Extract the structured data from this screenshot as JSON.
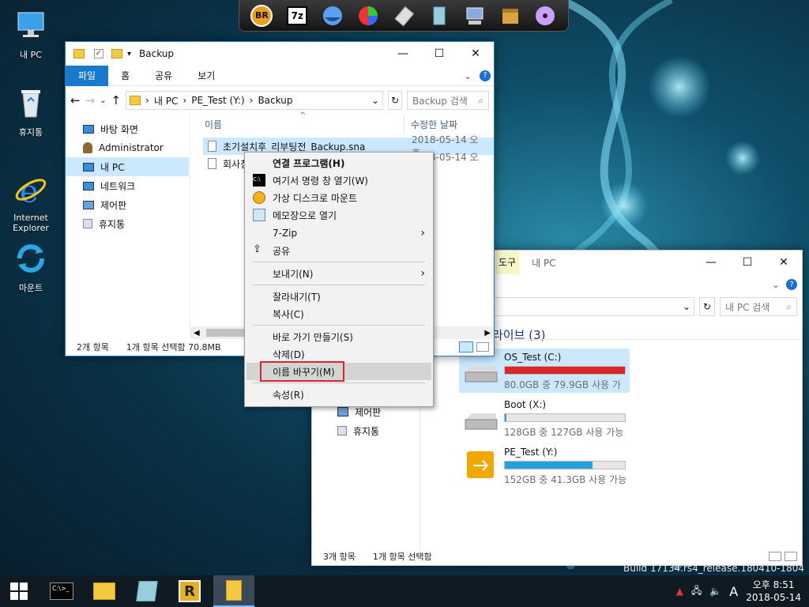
{
  "desktop": {
    "icons": [
      {
        "label": "내 PC"
      },
      {
        "label": "휴지통"
      },
      {
        "label": "Internet\nExplorer"
      },
      {
        "label": "마운트"
      }
    ],
    "build_text": "Build 17134.rs4_release.180410-1804"
  },
  "launcher": {
    "items": [
      "BR",
      "7z"
    ]
  },
  "backup_window": {
    "title": "Backup",
    "ribbon": [
      "파일",
      "홈",
      "공유",
      "보기"
    ],
    "breadcrumb": [
      "내 PC",
      "PE_Test (Y:)",
      "Backup"
    ],
    "search_placeholder": "Backup 검색",
    "nav": [
      "바탕 화면",
      "Administrator",
      "내 PC",
      "네트워크",
      "제어판",
      "휴지통"
    ],
    "columns": [
      "이름",
      "수정한 날짜"
    ],
    "files": [
      {
        "name": "초기설치후_리부팅전_Backup.sna",
        "date": "2018-05-14 오후..."
      },
      {
        "name": "회사칭",
        "date": "2018-05-14 오후..."
      }
    ],
    "status": {
      "count": "2개 항목",
      "selected": "1개 항목 선택함 70.8MB"
    }
  },
  "pc_window": {
    "tab_tools": "도구",
    "title": "내 PC",
    "search_placeholder": "내 PC 검색",
    "section": "라이브 (3)",
    "nav": [
      "제어판",
      "휴지통"
    ],
    "drives": [
      {
        "name": "OS_Test (C:)",
        "info": "80.0GB 중 79.9GB 사용 가",
        "fill": 0.999
      },
      {
        "name": "Boot (X:)",
        "info": "128GB 중 127GB 사용 가능",
        "fill": 0.01
      },
      {
        "name": "PE_Test (Y:)",
        "info": "152GB 중 41.3GB 사용 가능",
        "fill": 0.73
      }
    ],
    "status": {
      "count": "3개 항목",
      "selected": "1개 항목 선택함"
    }
  },
  "context_menu": {
    "items": [
      {
        "label": "연결 프로그램(H)",
        "bold": true
      },
      {
        "label": "여기서 명령 창 열기(W)"
      },
      {
        "label": "가상 디스크로 마운트"
      },
      {
        "label": "메모장으로 열기"
      },
      {
        "label": "7-Zip"
      },
      {
        "label": "공유"
      },
      {
        "label": "보내기(N)"
      },
      {
        "label": "잘라내기(T)"
      },
      {
        "label": "복사(C)"
      },
      {
        "label": "바로 가기 만들기(S)"
      },
      {
        "label": "삭제(D)"
      },
      {
        "label": "이름 바꾸기(M)",
        "highlighted": true
      },
      {
        "label": "속성(R)"
      }
    ],
    "highlight_color": "#d8262c"
  },
  "taskbar": {
    "clock_time": "오후 8:51",
    "clock_date": "2018-05-14",
    "ime": "A"
  }
}
